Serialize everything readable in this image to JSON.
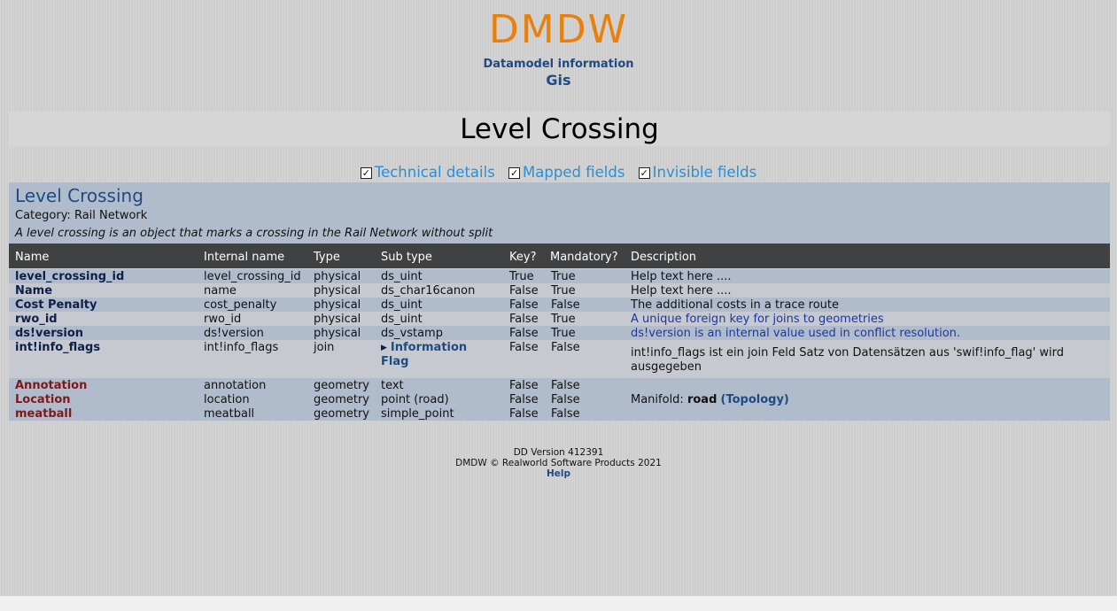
{
  "header": {
    "logo": "DMDW",
    "subtitle": "Datamodel information",
    "dataset": "Gis"
  },
  "page_title": "Level Crossing",
  "toggles": [
    {
      "label": "Technical details",
      "checked": true
    },
    {
      "label": "Mapped fields",
      "checked": true
    },
    {
      "label": "Invisible fields",
      "checked": true
    }
  ],
  "object": {
    "title": "Level Crossing",
    "category": "Category: Rail Network",
    "description": "A level crossing is an object that marks a crossing in the Rail Network without split"
  },
  "table": {
    "headers": [
      "Name",
      "Internal name",
      "Type",
      "Sub type",
      "Key?",
      "Mandatory?",
      "Description"
    ],
    "rows": [
      {
        "name": "level_crossing_id",
        "internal": "level_crossing_id",
        "type": "physical",
        "subtype": "ds_uint",
        "key": "True",
        "mandatory": "True",
        "description": "Help text here ...."
      },
      {
        "name": "Name",
        "internal": "name",
        "type": "physical",
        "subtype": "ds_char16canon",
        "key": "False",
        "mandatory": "True",
        "description": "Help text here ...."
      },
      {
        "name": "Cost Penalty",
        "internal": "cost_penalty",
        "type": "physical",
        "subtype": "ds_uint",
        "key": "False",
        "mandatory": "False",
        "description": "The additional costs in a trace route"
      },
      {
        "name": "rwo_id",
        "internal": "rwo_id",
        "type": "physical",
        "subtype": "ds_uint",
        "key": "False",
        "mandatory": "True",
        "description": "A unique foreign key for joins to geometries"
      },
      {
        "name": "ds!version",
        "internal": "ds!version",
        "type": "physical",
        "subtype": "ds_vstamp",
        "key": "False",
        "mandatory": "True",
        "description": "ds!version is an internal value used in conflict resolution."
      },
      {
        "name": "int!info_flags",
        "internal": "int!info_flags",
        "type": "join",
        "subtype_line1": "Information",
        "subtype_line2": "Flag",
        "key": "False",
        "mandatory": "False",
        "description_line1": "int!info_flags ist ein join Feld Satz von Datensätzen aus 'swif!info_flag' wird",
        "description_line2": "ausgegeben"
      },
      {
        "name": "Annotation",
        "internal": "annotation",
        "type": "geometry",
        "subtype": "text",
        "key": "False",
        "mandatory": "False",
        "description": ""
      },
      {
        "name": "Location",
        "internal": "location",
        "type": "geometry",
        "subtype": "point (road)",
        "key": "False",
        "mandatory": "False",
        "description_prefix": "Manifold: ",
        "description_bold": "road",
        "description_link": "(Topology)"
      },
      {
        "name": "meatball",
        "internal": "meatball",
        "type": "geometry",
        "subtype": "simple_point",
        "key": "False",
        "mandatory": "False",
        "description": ""
      }
    ]
  },
  "footer": {
    "version": "DD Version 412391",
    "copyright": "DMDW © Realworld Software Products 2021",
    "help": "Help"
  }
}
